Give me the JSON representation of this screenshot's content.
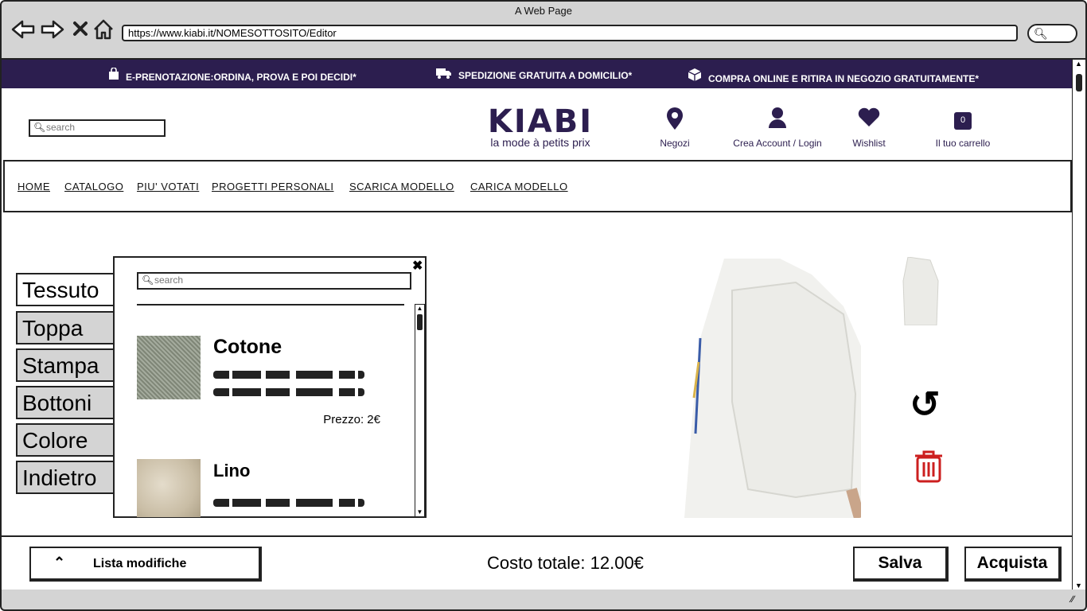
{
  "browser": {
    "window_title": "A Web Page",
    "url": "https://www.kiabi.it/NOMESOTTOSITO/Editor",
    "nav_icons": [
      "back-arrow-icon",
      "forward-arrow-icon",
      "close-x-icon",
      "home-icon"
    ]
  },
  "promo_bar": {
    "items": [
      {
        "icon": "shopping-bag-icon",
        "text": "E-PRENOTAZIONE:ORDINA, PROVA E POI DECIDI*"
      },
      {
        "icon": "truck-icon",
        "text": "SPEDIZIONE GRATUITA A DOMICILIO*"
      },
      {
        "icon": "package-icon",
        "text": "COMPRA ONLINE E RITIRA IN NEGOZIO GRATUITAMENTE*"
      }
    ],
    "background": "#2c1e4f"
  },
  "header": {
    "search_placeholder": "search",
    "logo": {
      "word": "KIABI",
      "tagline": "la mode à petits prix"
    },
    "items": [
      {
        "icon": "map-pin-icon",
        "label": "Negozi"
      },
      {
        "icon": "user-icon",
        "label": "Crea Account / Login"
      },
      {
        "icon": "heart-icon",
        "label": "Wishlist"
      },
      {
        "icon": "cart-icon",
        "label": "Il tuo carrello",
        "count": "0"
      }
    ]
  },
  "menu": [
    "HOME",
    "CATALOGO",
    "PIU' VOTATI",
    "PROGETTI PERSONALI",
    "SCARICA MODELLO",
    "CARICA MODELLO"
  ],
  "side_tabs": [
    "Tessuto",
    "Toppa",
    "Stampa",
    "Bottoni",
    "Colore",
    "Indietro"
  ],
  "active_tab": "Tessuto",
  "fabric_panel": {
    "search_placeholder": "search",
    "items": [
      {
        "name": "Cotone",
        "price": "Prezzo: 2€"
      },
      {
        "name": "Lino",
        "price": ""
      }
    ]
  },
  "footer": {
    "changes_label": "Lista modifiche",
    "total_cost": "Costo totale: 12.00€",
    "save_label": "Salva",
    "buy_label": "Acquista"
  },
  "colors": {
    "brand": "#2c1e4f",
    "trash": "#cc1f1f"
  }
}
